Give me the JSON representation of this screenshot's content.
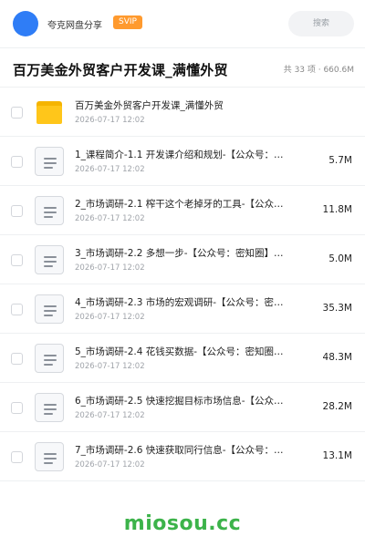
{
  "header": {
    "app_name": "夸克网盘分享",
    "badge": "SVIP",
    "search_placeholder": "搜索"
  },
  "folder": {
    "title": "百万美金外贸客户开发课_满懂外贸",
    "summary": "共 33 项 · 660.6M"
  },
  "files": [
    {
      "name": "百万美金外贸客户开发课_满懂外贸",
      "date": "2026-07-17 12:02",
      "size": "",
      "icon": "folder-icon"
    },
    {
      "name": "1_课程简介-1.1 开发课介绍和规划-【公众号：…",
      "date": "2026-07-17 12:02",
      "size": "5.7M",
      "icon": "document-icon"
    },
    {
      "name": "2_市场调研-2.1 榨干这个老掉牙的工具-【公众…",
      "date": "2026-07-17 12:02",
      "size": "11.8M",
      "icon": "document-icon"
    },
    {
      "name": "3_市场调研-2.2 多想一步-【公众号：密知圈】…",
      "date": "2026-07-17 12:02",
      "size": "5.0M",
      "icon": "document-icon"
    },
    {
      "name": "4_市场调研-2.3 市场的宏观调研-【公众号：密…",
      "date": "2026-07-17 12:02",
      "size": "35.3M",
      "icon": "document-icon"
    },
    {
      "name": "5_市场调研-2.4 花钱买数据-【公众号：密知圈…",
      "date": "2026-07-17 12:02",
      "size": "48.3M",
      "icon": "document-icon"
    },
    {
      "name": "6_市场调研-2.5 快速挖掘目标市场信息-【公众…",
      "date": "2026-07-17 12:02",
      "size": "28.2M",
      "icon": "document-icon"
    },
    {
      "name": "7_市场调研-2.6 快速获取同行信息-【公众号：…",
      "date": "2026-07-17 12:02",
      "size": "13.1M",
      "icon": "document-icon"
    }
  ],
  "watermark": "miosou.cc",
  "colors": {
    "avatar": "#2f7df6",
    "svip_badge": "#ff9a2e",
    "folder": "#ffc61a",
    "watermark": "#3cb34a"
  }
}
